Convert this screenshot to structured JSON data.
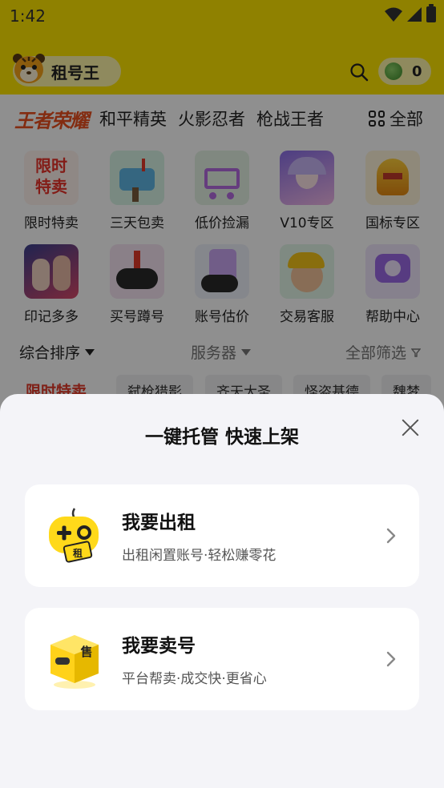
{
  "status_bar": {
    "time": "1:42"
  },
  "header": {
    "app_name": "租号王",
    "coin_count": "0"
  },
  "game_tabs": {
    "featured": "王者荣耀",
    "items": [
      "和平精英",
      "火影忍者",
      "枪战王者"
    ],
    "all_label": "全部"
  },
  "shortcuts": [
    {
      "label": "限时特卖",
      "icon": "flash-sale-icon"
    },
    {
      "label": "三天包卖",
      "icon": "mailbox-icon"
    },
    {
      "label": "低价捡漏",
      "icon": "shopping-cart-icon"
    },
    {
      "label": "V10专区",
      "icon": "character-portrait-icon"
    },
    {
      "label": "国标专区",
      "icon": "golden-helmet-icon"
    },
    {
      "label": "印记多多",
      "icon": "heroes-poster-icon"
    },
    {
      "label": "买号蹲号",
      "icon": "gamepad-claw-icon"
    },
    {
      "label": "账号估价",
      "icon": "calculator-icon"
    },
    {
      "label": "交易客服",
      "icon": "support-character-icon"
    },
    {
      "label": "帮助中心",
      "icon": "help-bubble-icon"
    }
  ],
  "shortcut_text_icons": {
    "flash_sale": "限时\n特卖"
  },
  "filters": {
    "sort": "综合排序",
    "server": "服务器",
    "all_filter": "全部筛选"
  },
  "chips": [
    "限时特卖",
    "弑枪猎影",
    "齐天大圣",
    "怪盗基德",
    "魏梦"
  ],
  "sheet": {
    "title": "一键托管 快速上架",
    "options": [
      {
        "title": "我要出租",
        "subtitle": "出租闲置账号·轻松赚零花",
        "icon": "gamepad-rent-icon",
        "badge": "租"
      },
      {
        "title": "我要卖号",
        "subtitle": "平台帮卖·成交快·更省心",
        "icon": "sell-box-icon",
        "badge": "售"
      }
    ]
  },
  "colors": {
    "brand_yellow": "#ffe600",
    "featured_red": "#e94f1f",
    "sheet_bg": "#f4f4f8"
  }
}
